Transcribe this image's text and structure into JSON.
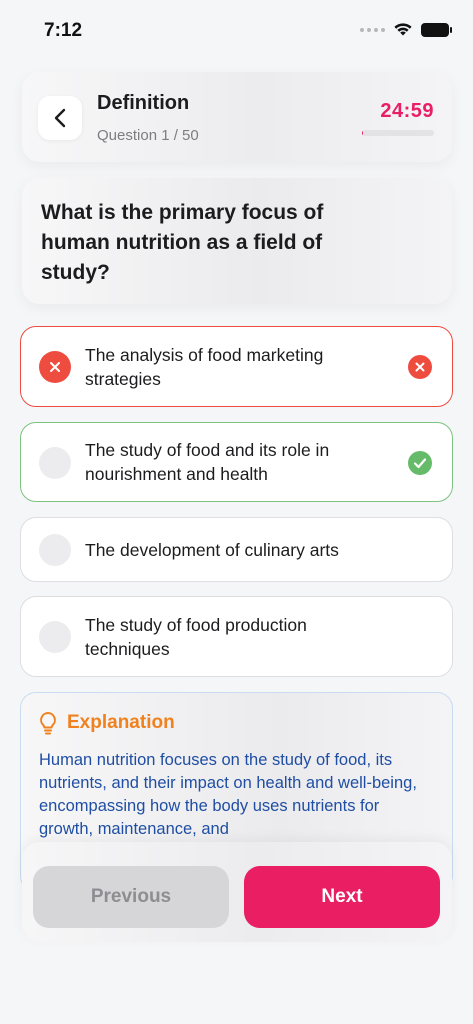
{
  "status_bar": {
    "time": "7:12"
  },
  "header": {
    "title": "Definition",
    "question_counter": "Question 1 / 50",
    "timer": "24:59",
    "timer_progress": 0.02
  },
  "question": {
    "text": "What is the primary focus of human nutrition as a field of study?"
  },
  "options": [
    {
      "label": "The analysis of food marketing strategies",
      "state": "incorrect-selected"
    },
    {
      "label": "The study of food and its role in nourishment and health",
      "state": "correct"
    },
    {
      "label": "The development of culinary arts",
      "state": "neutral"
    },
    {
      "label": "The study of food production techniques",
      "state": "neutral"
    }
  ],
  "explanation": {
    "title": "Explanation",
    "body": "Human nutrition focuses on the study of food, its nutrients, and their impact on health and well-being, encompassing how the body uses nutrients for growth, maintenance, and"
  },
  "navigation": {
    "previous_label": "Previous",
    "next_label": "Next"
  },
  "colors": {
    "accent": "#e91e63",
    "incorrect": "#ef4c40",
    "correct": "#66bb6a",
    "explanation_title": "#f0811e",
    "explanation_text": "#1f4ea3"
  },
  "icons": [
    "wifi-icon",
    "battery-icon",
    "back-chevron-icon",
    "x-icon",
    "check-icon",
    "lightbulb-icon"
  ]
}
